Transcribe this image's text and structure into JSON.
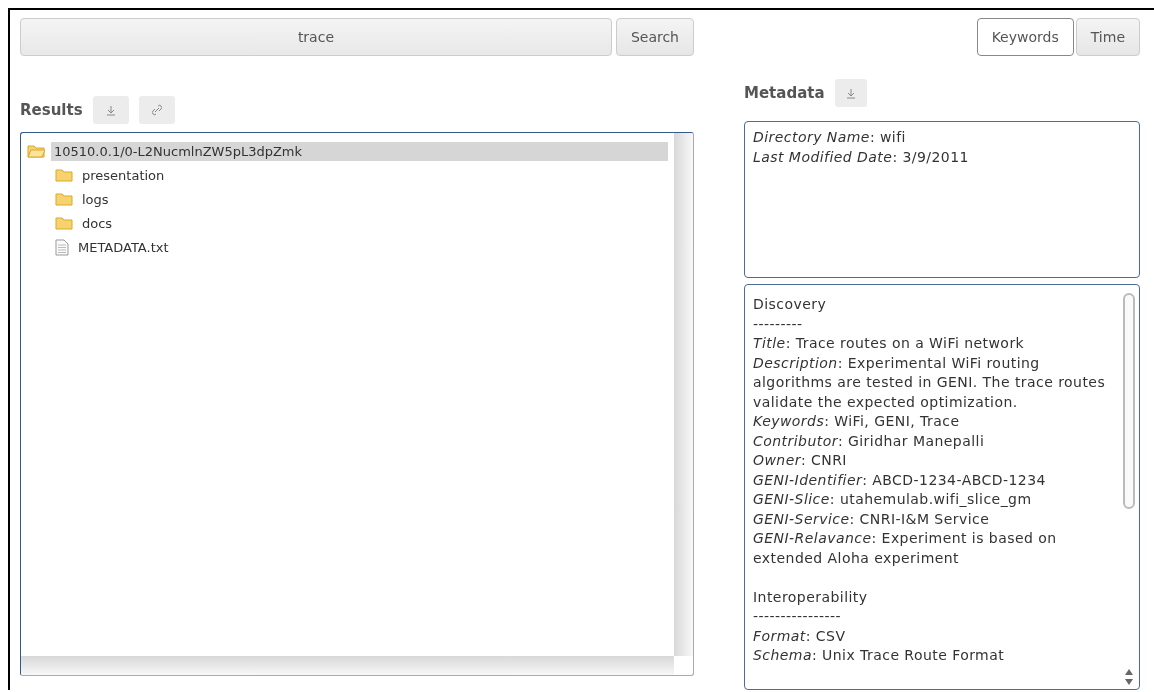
{
  "search": {
    "value": "trace",
    "button": "Search"
  },
  "tabs": [
    {
      "label": "Keywords",
      "selected": true
    },
    {
      "label": "Time",
      "selected": false
    }
  ],
  "results": {
    "title": "Results",
    "tree": [
      {
        "label": "10510.0.1/0-L2NucmlnZW5pL3dpZmk",
        "kind": "folder",
        "expanded": true,
        "selected": true,
        "children": [
          {
            "label": "presentation",
            "kind": "folder",
            "expanded": false,
            "selected": false
          },
          {
            "label": "logs",
            "kind": "folder",
            "expanded": false,
            "selected": false
          },
          {
            "label": "docs",
            "kind": "folder",
            "expanded": false,
            "selected": false
          },
          {
            "label": "METADATA.txt",
            "kind": "file",
            "selected": false
          }
        ]
      }
    ]
  },
  "metadata": {
    "title": "Metadata",
    "summary": [
      "*Directory Name*: wifi",
      "*Last Modified Date*: 3/9/2011"
    ],
    "details": [
      {
        "kind": "heading",
        "text": "Discovery"
      },
      {
        "kind": "rule",
        "text": "---------"
      },
      {
        "kind": "field",
        "text": "*Title*: Trace routes on a WiFi network"
      },
      {
        "kind": "field",
        "text": "*Description*: Experimental WiFi routing algorithms are tested in GENI. The trace routes validate the expected optimization."
      },
      {
        "kind": "field",
        "text": "*Keywords*: WiFi, GENI, Trace"
      },
      {
        "kind": "field",
        "text": "*Contributor*: Giridhar Manepalli"
      },
      {
        "kind": "field",
        "text": "*Owner*: CNRI"
      },
      {
        "kind": "field",
        "text": "*GENI-Identifier*: ABCD-1234-ABCD-1234"
      },
      {
        "kind": "field",
        "text": "*GENI-Slice*: utahemulab.wifi_slice_gm"
      },
      {
        "kind": "field",
        "text": "*GENI-Service*: CNRI-I&M Service"
      },
      {
        "kind": "field",
        "text": "*GENI-Relavance*: Experiment is based on extended Aloha experiment"
      },
      {
        "kind": "blank"
      },
      {
        "kind": "heading",
        "text": "Interoperability"
      },
      {
        "kind": "rule",
        "text": "----------------"
      },
      {
        "kind": "field",
        "text": "*Format*: CSV"
      },
      {
        "kind": "field",
        "text": "*Schema*: Unix Trace Route Format"
      }
    ]
  }
}
